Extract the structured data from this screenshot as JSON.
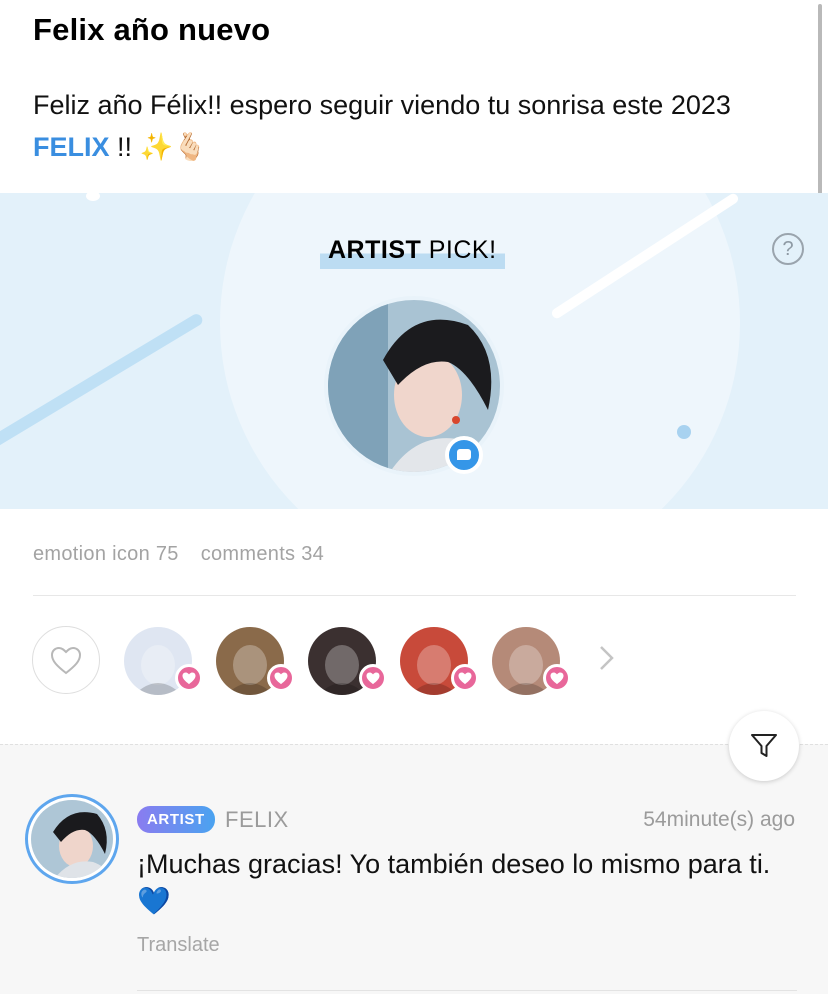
{
  "post": {
    "title": "Felix año nuevo",
    "body_before": "Feliz año Félix!! espero seguir viendo tu sonrisa este 2023 ",
    "mention": "FELIX",
    "body_after": " !! ✨🫰🏻"
  },
  "artist_pick": {
    "title_bold": "ARTIST",
    "title_rest": " PICK!",
    "help": "?"
  },
  "stats": {
    "emotion": "emotion icon 75",
    "comments": "comments 34"
  },
  "reactions": {
    "avatar_colors": [
      "#dfe6f2",
      "#8a6a4a",
      "#3b3030",
      "#c84a3a",
      "#b58a78"
    ],
    "more": "chevron-right"
  },
  "comment": {
    "badge": "ARTIST",
    "author": "FELIX",
    "time": "54minute(s) ago",
    "text": "¡Muchas gracias! Yo también deseo lo mismo para ti.💙",
    "translate": "Translate"
  },
  "colors": {
    "accent": "#3a8ee0",
    "heart": "#e8679a",
    "banner": "#e3f1fa"
  }
}
